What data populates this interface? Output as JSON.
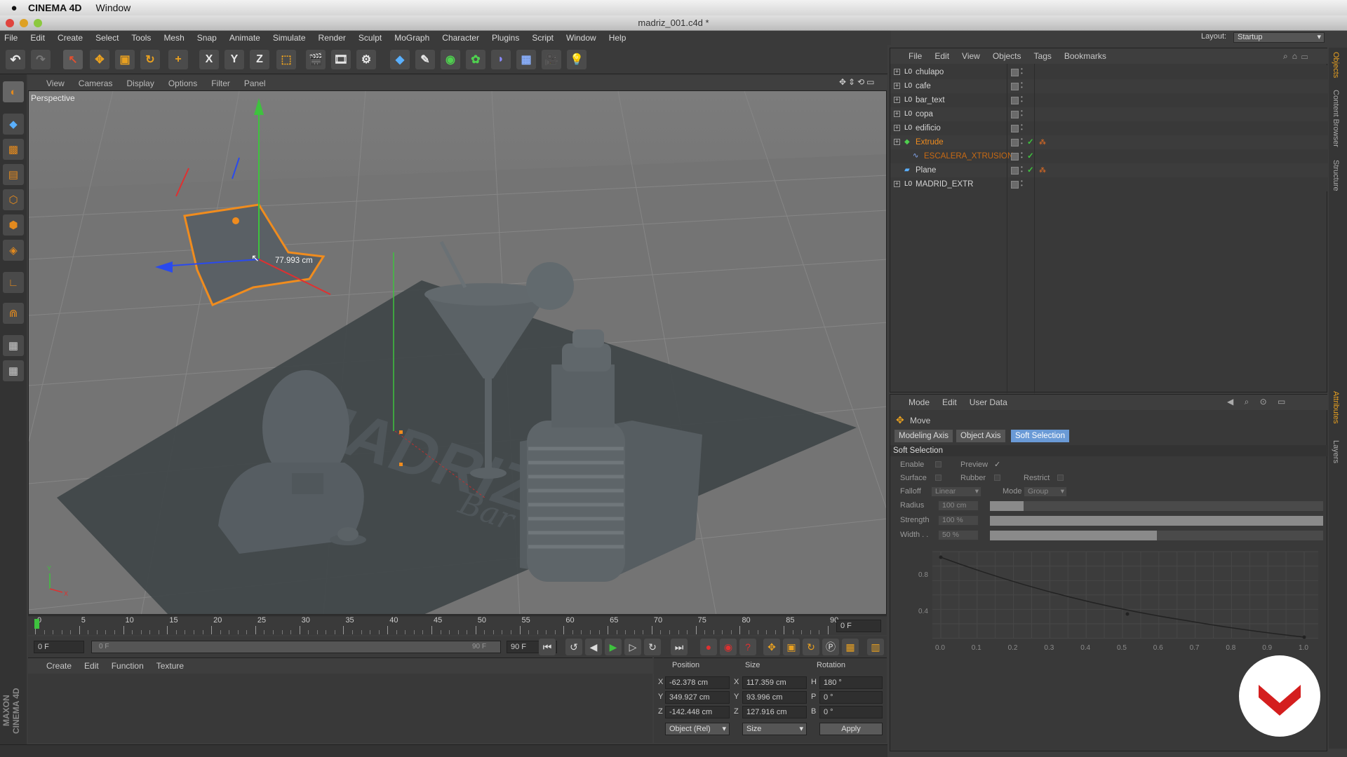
{
  "mac": {
    "app_name": "CINEMA 4D",
    "menu_window": "Window"
  },
  "window": {
    "title": "madriz_001.c4d *"
  },
  "menus": [
    "File",
    "Edit",
    "Create",
    "Select",
    "Tools",
    "Mesh",
    "Snap",
    "Animate",
    "Simulate",
    "Render",
    "Sculpt",
    "MoGraph",
    "Character",
    "Plugins",
    "Script",
    "Window",
    "Help"
  ],
  "layout": {
    "label": "Layout:",
    "value": "Startup"
  },
  "toolbar": {
    "x_label": "X",
    "y_label": "Y",
    "z_label": "Z"
  },
  "viewport": {
    "menus": [
      "View",
      "Cameras",
      "Display",
      "Options",
      "Filter",
      "Panel"
    ],
    "camera_label": "Perspective",
    "measure_text": "77.993 cm",
    "scene_text": "MADRIZ",
    "scene_script": "Bar",
    "axis_y": "Y",
    "axis_x": "X"
  },
  "timeline": {
    "ticks": [
      "0",
      "5",
      "10",
      "15",
      "20",
      "25",
      "30",
      "35",
      "40",
      "45",
      "50",
      "55",
      "60",
      "65",
      "70",
      "75",
      "80",
      "85",
      "90"
    ],
    "current_frame": "0 F"
  },
  "transport": {
    "start_field": "0 F",
    "range_start": "0 F",
    "range_end": "90 F",
    "end_field": "90 F"
  },
  "material_panel": {
    "menus": [
      "Create",
      "Edit",
      "Function",
      "Texture"
    ]
  },
  "coords": {
    "headers": {
      "position": "Position",
      "size": "Size",
      "rotation": "Rotation"
    },
    "rows": [
      {
        "axis": "X",
        "pos": "-62.378 cm",
        "size_axis": "X",
        "size": "117.359 cm",
        "rot_axis": "H",
        "rot": "180 °"
      },
      {
        "axis": "Y",
        "pos": "349.927 cm",
        "size_axis": "Y",
        "size": "93.996 cm",
        "rot_axis": "P",
        "rot": "0 °"
      },
      {
        "axis": "Z",
        "pos": "-142.448 cm",
        "size_axis": "Z",
        "size": "127.916 cm",
        "rot_axis": "B",
        "rot": "0 °"
      }
    ],
    "mode_dropdown": "Object (Rel)",
    "size_dropdown": "Size",
    "apply_label": "Apply"
  },
  "maxon_logo_text": "MAXON CINEMA 4D",
  "object_manager": {
    "menus": [
      "File",
      "Edit",
      "View",
      "Objects",
      "Tags",
      "Bookmarks"
    ],
    "objects": [
      {
        "name": "chulapo",
        "icon": "null-icon",
        "expandable": true,
        "color": "#d4d4d4",
        "check": false,
        "tag": false,
        "indent": false
      },
      {
        "name": "cafe",
        "icon": "null-icon",
        "expandable": true,
        "color": "#d4d4d4",
        "check": false,
        "tag": false,
        "indent": false
      },
      {
        "name": "bar_text",
        "icon": "null-icon",
        "expandable": true,
        "color": "#d4d4d4",
        "check": false,
        "tag": false,
        "indent": false
      },
      {
        "name": "copa",
        "icon": "null-icon",
        "expandable": true,
        "color": "#d4d4d4",
        "check": false,
        "tag": false,
        "indent": false
      },
      {
        "name": "edificio",
        "icon": "null-icon",
        "expandable": true,
        "color": "#d4d4d4",
        "check": false,
        "tag": false,
        "indent": false
      },
      {
        "name": "Extrude",
        "icon": "extrude-icon",
        "expandable": true,
        "color": "#f08c1e",
        "check": true,
        "tag": true,
        "indent": false
      },
      {
        "name": "ESCALERA_XTRUSION",
        "icon": "spline-icon",
        "expandable": false,
        "color": "#c86a14",
        "check": true,
        "tag": false,
        "indent": true
      },
      {
        "name": "Plane",
        "icon": "plane-icon",
        "expandable": false,
        "color": "#d4d4d4",
        "check": true,
        "tag": true,
        "indent": false
      },
      {
        "name": "MADRID_EXTR",
        "icon": "null-icon",
        "expandable": true,
        "color": "#d4d4d4",
        "check": false,
        "tag": false,
        "indent": false
      }
    ]
  },
  "attributes": {
    "menus": [
      "Mode",
      "Edit",
      "User Data"
    ],
    "tool_name": "Move",
    "tabs": [
      "Modeling Axis",
      "Object Axis",
      "Soft Selection"
    ],
    "active_tab": "Soft Selection",
    "section_title": "Soft Selection",
    "enable_label": "Enable",
    "preview_label": "Preview",
    "preview_check": "✓",
    "surface_label": "Surface",
    "rubber_label": "Rubber",
    "restrict_label": "Restrict",
    "falloff_label": "Falloff",
    "falloff_value": "Linear",
    "mode_label": "Mode",
    "mode_value": "Group",
    "radius_label": "Radius",
    "radius_value": "100 cm",
    "radius_fill": 0.1,
    "strength_label": "Strength",
    "strength_value": "100 %",
    "strength_fill": 1.0,
    "width_label": "Width . .",
    "width_value": "50 %",
    "width_fill": 0.5,
    "graph_y_ticks": [
      "0.8",
      "0.4"
    ],
    "graph_x_ticks": [
      "0.0",
      "0.1",
      "0.2",
      "0.3",
      "0.4",
      "0.5",
      "0.6",
      "0.7",
      "0.8",
      "0.9",
      "1.0"
    ]
  },
  "side_tabs": [
    "Objects",
    "Content Browser",
    "Structure",
    "Attributes",
    "Layers"
  ]
}
